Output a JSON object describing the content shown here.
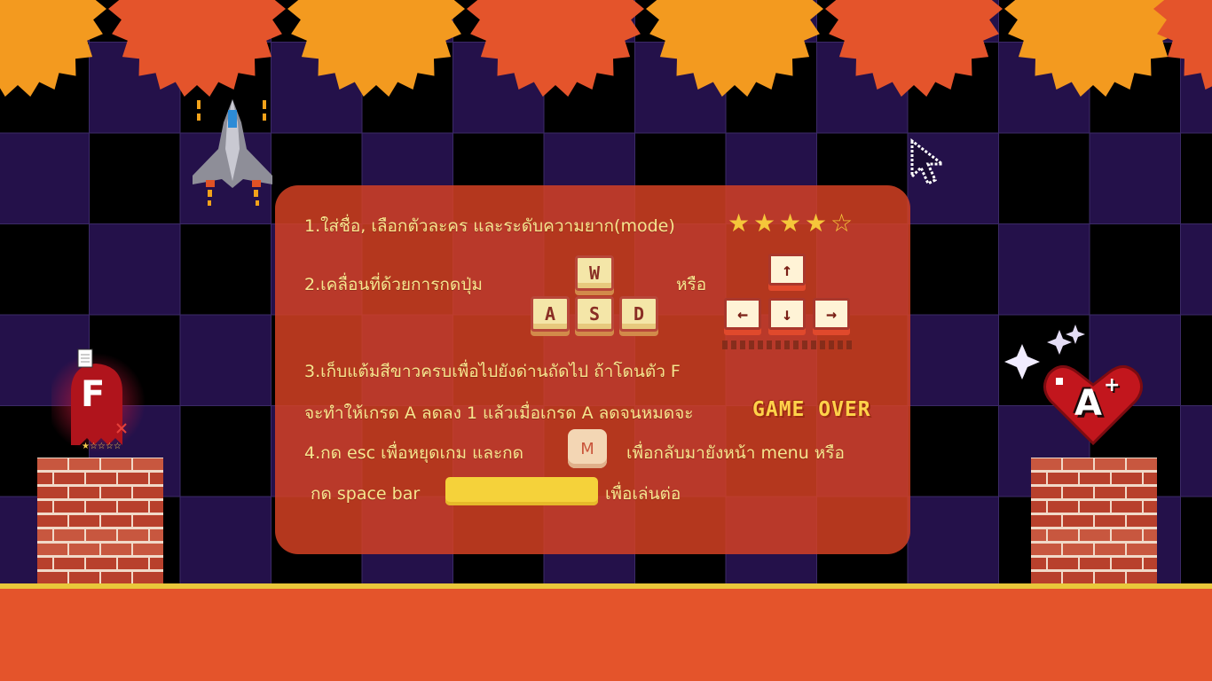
{
  "instructions": {
    "line1": "1.ใส่ชื่อ, เลือกตัวละคร และระดับความยาก(mode)",
    "line2": "2.เคลื่อนที่ด้วยการกดปุ่ม",
    "or_label": "หรือ",
    "line3": "3.เก็บแต้มสีขาวครบเพื่อไปยังด่านถัดไป ถ้าโดนตัว F",
    "line4": "จะทำให้เกรด A  ลดลง 1 แล้วเมื่อเกรด A ลดจนหมดจะ",
    "game_over": "GAME OVER",
    "line5_a": "4.กด esc เพื่อหยุดเกม และกด",
    "line5_b": "เพื่อกลับมายังหน้า menu หรือ",
    "line6_a": "กด space bar",
    "line6_b": "เพื่อเล่นต่อ"
  },
  "difficulty_rating": {
    "filled": 4,
    "total": 5
  },
  "keys": {
    "wasd": [
      "W",
      "A",
      "S",
      "D"
    ],
    "arrows": [
      "↑",
      "←",
      "↓",
      "→"
    ],
    "menu_key": "M"
  },
  "characters": {
    "enemy_label": "F",
    "player_label": "A",
    "player_plus": "+"
  },
  "colors": {
    "panel": "#d64224",
    "text": "#f6e58e",
    "sun_orange": "#f39a1f",
    "sun_red": "#e4542b",
    "checker_purple": "#24114a",
    "ground": "#e4542b"
  }
}
